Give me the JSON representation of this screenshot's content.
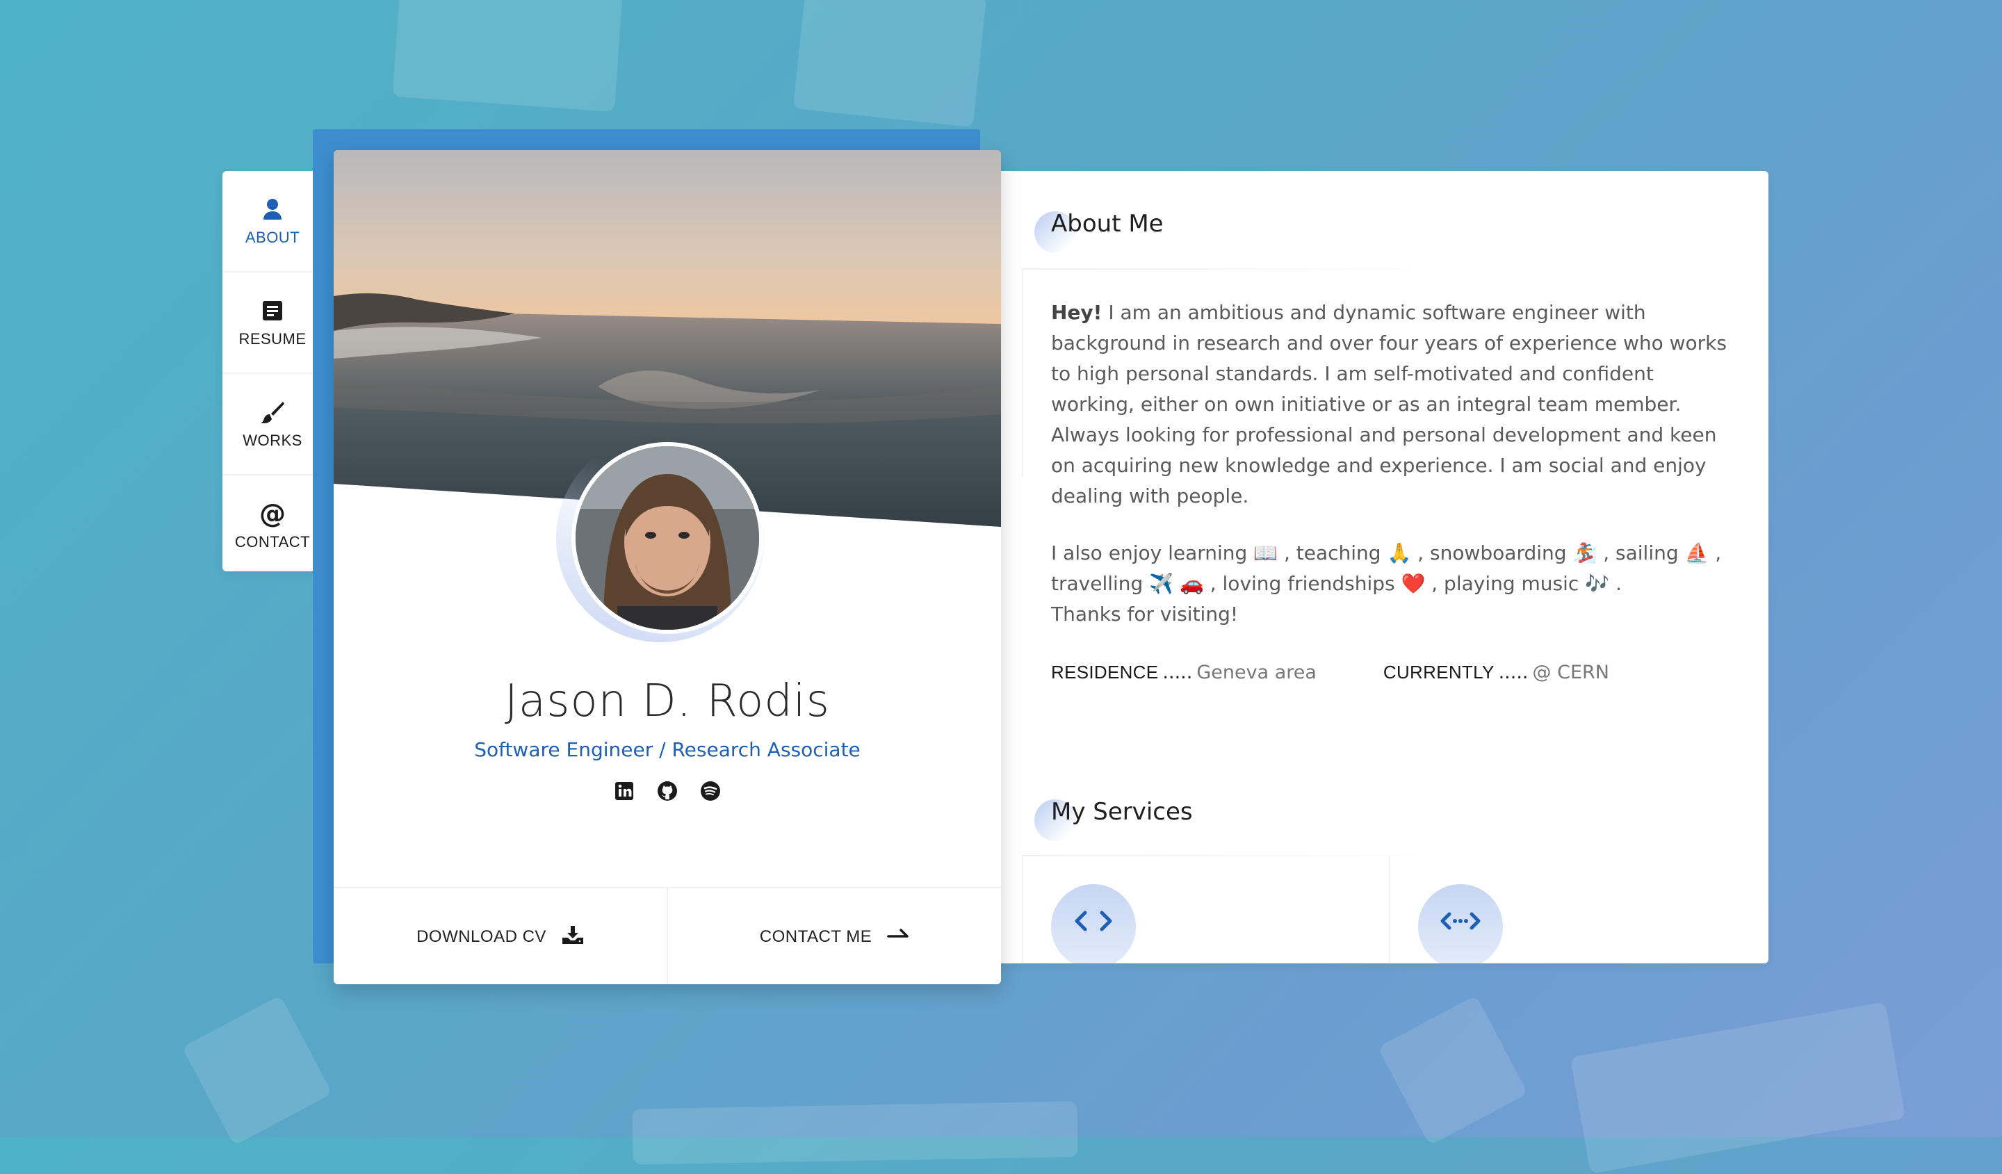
{
  "nav": {
    "items": [
      {
        "label": "ABOUT",
        "icon": "user-icon",
        "active": true
      },
      {
        "label": "RESUME",
        "icon": "document-icon",
        "active": false
      },
      {
        "label": "WORKS",
        "icon": "paintbrush-icon",
        "active": false
      },
      {
        "label": "CONTACT",
        "icon": "at-sign-icon",
        "active": false
      }
    ]
  },
  "profile": {
    "name": "Jason D. Rodis",
    "role": "Software Engineer / Research Associate",
    "socials": [
      "linkedin-icon",
      "github-icon",
      "spotify-icon"
    ],
    "download_label": "DOWNLOAD CV",
    "contact_label": "CONTACT ME"
  },
  "about": {
    "title": "About Me",
    "hey": "Hey!",
    "paragraph1": " I am an ambitious and dynamic software engineer with background in research and over four years of experience who works to high personal standards. I am self-motivated and confident working, either on own initiative or as an integral team member. Always looking for professional and personal development and keen on acquiring new knowledge and experience. I am social and enjoy dealing with people.",
    "paragraph2_line1": "I also enjoy learning 📖 , teaching 🙏 , snowboarding 🏂 , sailing ⛵ ,",
    "paragraph2_line2": "travelling ✈️ 🚗 , loving friendships ❤️ , playing music 🎶 .",
    "paragraph2_line3": "Thanks for visiting!",
    "residence_label": "RESIDENCE",
    "residence_value": "Geneva area",
    "currently_label": "CURRENTLY",
    "currently_value": "@ CERN",
    "dots": "....."
  },
  "services": {
    "title": "My Services",
    "icons": [
      "code-icon",
      "code-arrows-icon"
    ]
  },
  "colors": {
    "accent": "#1d5fb5",
    "backdrop": "#3d8ecf"
  }
}
